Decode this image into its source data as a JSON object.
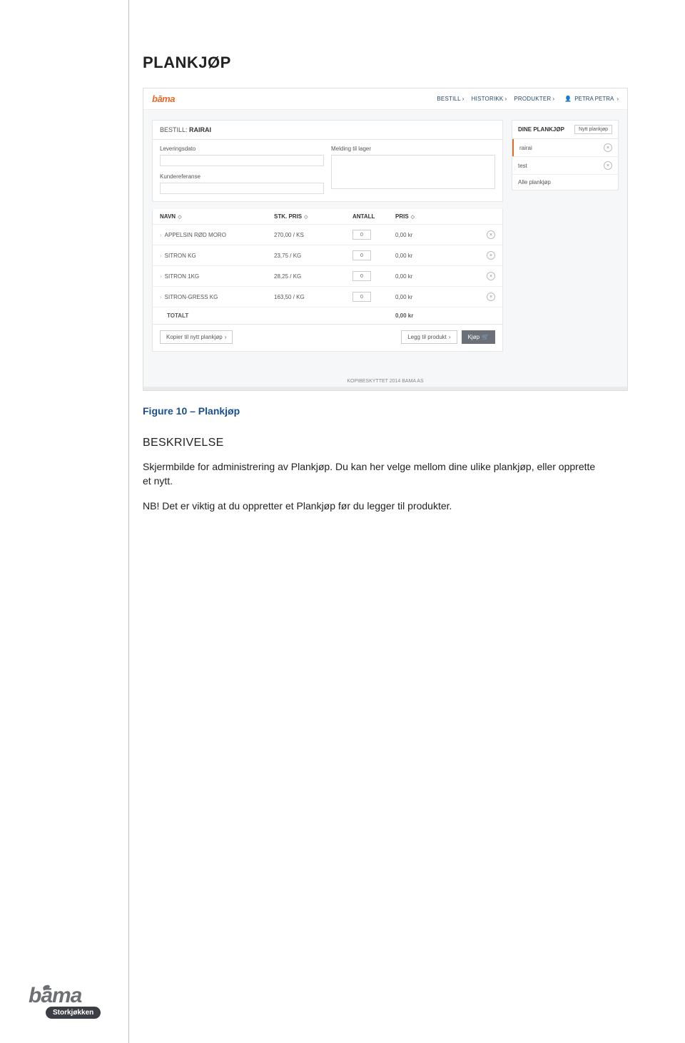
{
  "doc": {
    "heading": "PLANKJØP",
    "caption": "Figure 10 – Plankjøp",
    "subheading": "BESKRIVELSE",
    "para1": "Skjermbilde for administrering av Plankjøp. Du kan her velge mellom dine ulike plankjøp, eller opprette et nytt.",
    "para2": "NB! Det er viktig at du oppretter et Plankjøp før du legger til produkter."
  },
  "shot": {
    "logo": "bāma",
    "nav": {
      "bestill": "BESTILL",
      "historikk": "HISTORIKK",
      "produkter": "PRODUKTER"
    },
    "user": "PETRA PETRA",
    "main_title_prefix": "BESTILL: ",
    "main_title_value": "RAIRAI",
    "form": {
      "leveringsdato": "Leveringsdato",
      "kundereferanse": "Kundereferanse",
      "melding": "Melding til lager"
    },
    "thead": {
      "navn": "NAVN",
      "stkpris": "STK. PRIS",
      "antall": "ANTALL",
      "pris": "PRIS"
    },
    "rows": [
      {
        "name": "APPELSIN RØD MORO",
        "unit": "270,00 / KS",
        "qty": "0",
        "price": "0,00 kr"
      },
      {
        "name": "SITRON KG",
        "unit": "23,75 / KG",
        "qty": "0",
        "price": "0,00 kr"
      },
      {
        "name": "SITRON 1KG",
        "unit": "28,25 / KG",
        "qty": "0",
        "price": "0,00 kr"
      },
      {
        "name": "SITRON-GRESS KG",
        "unit": "163,50 / KG",
        "qty": "0",
        "price": "0,00 kr"
      }
    ],
    "total_label": "TOTALT",
    "total_value": "0,00 kr",
    "actions": {
      "copy": "Kopier til nytt plankjøp",
      "add": "Legg til produkt",
      "buy": "Kjøp"
    },
    "side": {
      "title": "DINE PLANKJØP",
      "new_btn": "Nytt plankjøp",
      "items": [
        {
          "label": "rairai",
          "deletable": true,
          "active": true
        },
        {
          "label": "test",
          "deletable": true,
          "active": false
        },
        {
          "label": "Alle plankjøp",
          "deletable": false,
          "active": false
        }
      ]
    },
    "copyright": "KOPIBESKYTTET 2014 BAMA AS"
  },
  "footer": {
    "brand": "bāma",
    "sub": "Storkjøkken"
  },
  "glyphs": {
    "chev_right": "›",
    "sort": "◇",
    "x": "×",
    "cart": "🛒",
    "user": "👤"
  }
}
